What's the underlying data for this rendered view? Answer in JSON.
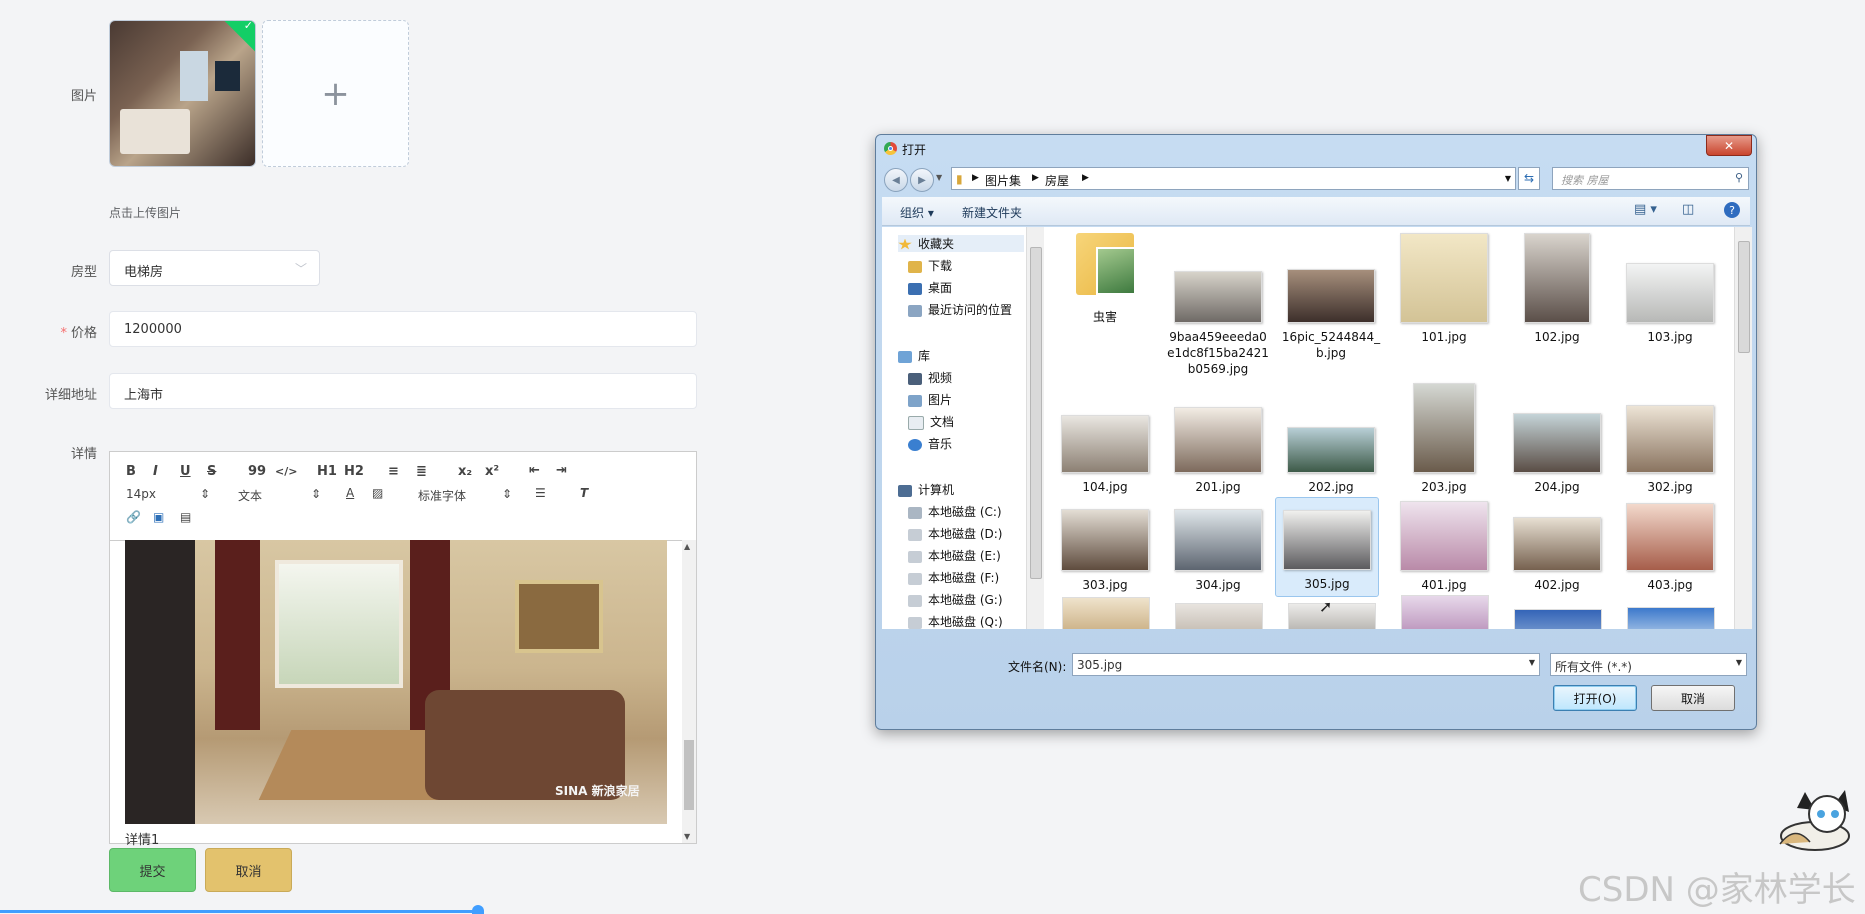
{
  "form": {
    "labels": {
      "image": "图片",
      "room_type": "房型",
      "price": "价格",
      "address": "详细地址",
      "detail": "详情"
    },
    "upload_hint": "点击上传图片",
    "upload_add": "+",
    "uploaded_check": "✓",
    "required_star": "*",
    "room_type_value": "电梯房",
    "price_value": "1200000",
    "address_value": "上海市",
    "editor": {
      "toolbar_row1": [
        "B",
        "I",
        "U",
        "S",
        "99",
        "</>",
        "H1",
        "H2",
        "≡",
        "≣",
        "x₂",
        "x²",
        "⇤",
        "⇥"
      ],
      "font_size": "14px",
      "text_type": "文本",
      "font_family": "标准字体",
      "image_watermark": "SINA 新浪家居",
      "caption": "详情1"
    },
    "buttons": {
      "submit": "提交",
      "cancel": "取消"
    }
  },
  "dialog": {
    "title": "打开",
    "close": "✕",
    "breadcrumb": [
      "图片集",
      "房屋"
    ],
    "search_placeholder": "搜索 房屋",
    "commands": {
      "organize": "组织 ▾",
      "new_folder": "新建文件夹"
    },
    "nav": {
      "favorites": "收藏夹",
      "downloads": "下载",
      "desktop": "桌面",
      "recent": "最近访问的位置",
      "libraries": "库",
      "videos": "视频",
      "pictures": "图片",
      "documents": "文档",
      "music": "音乐",
      "computer": "计算机",
      "drives": [
        "本地磁盘 (C:)",
        "本地磁盘 (D:)",
        "本地磁盘 (E:)",
        "本地磁盘 (F:)",
        "本地磁盘 (G:)",
        "本地磁盘 (Q:)"
      ]
    },
    "files": [
      "虫害",
      "9baa459eeeda0e1dc8f15ba2421b0569.jpg",
      "16pic_5244844_b.jpg",
      "101.jpg",
      "102.jpg",
      "103.jpg",
      "104.jpg",
      "201.jpg",
      "202.jpg",
      "203.jpg",
      "204.jpg",
      "302.jpg",
      "303.jpg",
      "304.jpg",
      "305.jpg",
      "401.jpg",
      "402.jpg",
      "403.jpg"
    ],
    "filename_label": "文件名(N):",
    "filename_value": "305.jpg",
    "filter_value": "所有文件 (*.*)",
    "open_button": "打开(O)",
    "cancel_button": "取消"
  },
  "watermark": "CSDN @家林学长",
  "colors": {
    "submit": "#6ed27a",
    "cancel": "#e3c26d",
    "selection": "#d9ebfb",
    "accent": "#409eff"
  }
}
